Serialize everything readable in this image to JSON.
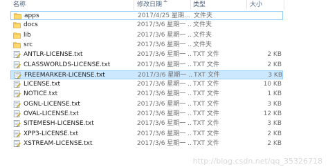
{
  "columns": {
    "name": "名称",
    "date": "修改日期",
    "type": "类型",
    "size": "大小"
  },
  "files": [
    {
      "name": "apps",
      "date": "2017/4/25 星期...",
      "type": "文件夹",
      "size": "",
      "kind": "folder"
    },
    {
      "name": "docs",
      "date": "2017/3/6 星期一 ...",
      "type": "文件夹",
      "size": "",
      "kind": "folder"
    },
    {
      "name": "lib",
      "date": "2017/3/6 星期一 ...",
      "type": "文件夹",
      "size": "",
      "kind": "folder"
    },
    {
      "name": "src",
      "date": "2017/3/6 星期一 ...",
      "type": "文件夹",
      "size": "",
      "kind": "folder"
    },
    {
      "name": "ANTLR-LICENSE.txt",
      "date": "2017/3/6 星期一 ...",
      "type": "TXT 文件",
      "size": "2 KB",
      "kind": "txt"
    },
    {
      "name": "CLASSWORLDS-LICENSE.txt",
      "date": "2017/3/6 星期一 ...",
      "type": "TXT 文件",
      "size": "2 KB",
      "kind": "txt"
    },
    {
      "name": "FREEMARKER-LICENSE.txt",
      "date": "2017/3/6 星期一 ...",
      "type": "TXT 文件",
      "size": "3 KB",
      "kind": "txt"
    },
    {
      "name": "LICENSE.txt",
      "date": "2017/3/6 星期一 ...",
      "type": "TXT 文件",
      "size": "10 KB",
      "kind": "txt"
    },
    {
      "name": "NOTICE.txt",
      "date": "2017/3/6 星期一 ...",
      "type": "TXT 文件",
      "size": "1 KB",
      "kind": "txt"
    },
    {
      "name": "OGNL-LICENSE.txt",
      "date": "2017/3/6 星期一 ...",
      "type": "TXT 文件",
      "size": "3 KB",
      "kind": "txt"
    },
    {
      "name": "OVAL-LICENSE.txt",
      "date": "2017/3/6 星期一 ...",
      "type": "TXT 文件",
      "size": "12 KB",
      "kind": "txt"
    },
    {
      "name": "SITEMESH-LICENSE.txt",
      "date": "2017/3/6 星期一 ...",
      "type": "TXT 文件",
      "size": "3 KB",
      "kind": "txt"
    },
    {
      "name": "XPP3-LICENSE.txt",
      "date": "2017/3/6 星期一 ...",
      "type": "TXT 文件",
      "size": "2 KB",
      "kind": "txt"
    },
    {
      "name": "XSTREAM-LICENSE.txt",
      "date": "2017/3/6 星期一 ...",
      "type": "TXT 文件",
      "size": "2 KB",
      "kind": "txt"
    }
  ],
  "selected_row": "FREEMARKER-LICENSE.txt",
  "focused_row": "apps",
  "watermark": "http://blog.csdn.net/qq_35326718",
  "colors": {
    "selection_fill": "#cce8ff",
    "selection_border": "#99d1ff",
    "folder": "#e8c25c",
    "header_text": "#4c607a"
  }
}
